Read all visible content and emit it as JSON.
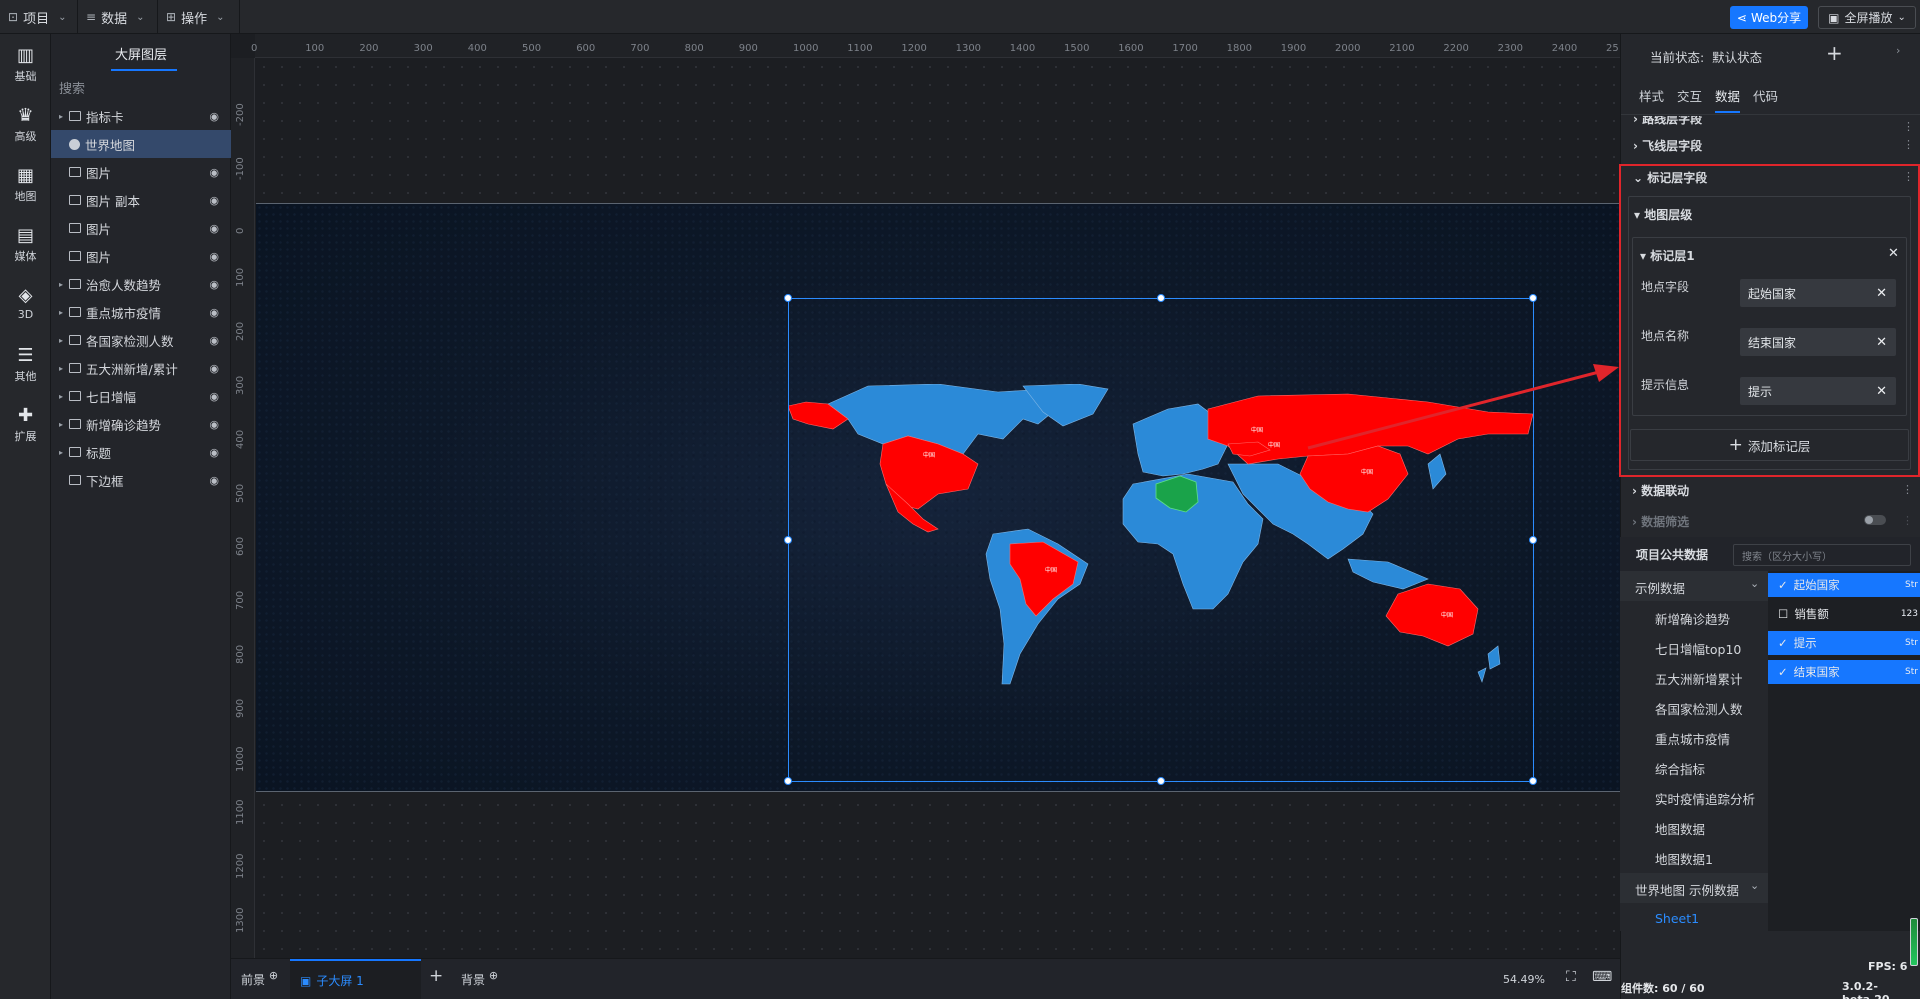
{
  "topbar": {
    "menus": [
      {
        "label": "项目",
        "icon": "project-icon"
      },
      {
        "label": "数据",
        "icon": "database-icon"
      },
      {
        "label": "操作",
        "icon": "grid-icon"
      }
    ],
    "web_share": "Web分享",
    "fullscreen": "全屏播放"
  },
  "left_rail": [
    {
      "label": "基础",
      "icon": "bar-chart-icon"
    },
    {
      "label": "高级",
      "icon": "crown-icon"
    },
    {
      "label": "地图",
      "icon": "map-icon"
    },
    {
      "label": "媒体",
      "icon": "media-icon"
    },
    {
      "label": "3D",
      "icon": "cube-icon"
    },
    {
      "label": "其他",
      "icon": "stack-icon"
    },
    {
      "label": "扩展",
      "icon": "puzzle-icon"
    }
  ],
  "layers": {
    "tab": "大屏图层",
    "search_placeholder": "搜索",
    "items": [
      {
        "label": "指标卡",
        "group": true,
        "selected": false
      },
      {
        "label": "世界地图",
        "group": false,
        "selected": true
      },
      {
        "label": "图片",
        "group": false,
        "selected": false
      },
      {
        "label": "图片 副本",
        "group": false,
        "selected": false
      },
      {
        "label": "图片",
        "group": false,
        "selected": false
      },
      {
        "label": "图片",
        "group": false,
        "selected": false
      },
      {
        "label": "治愈人数趋势",
        "group": true,
        "selected": false
      },
      {
        "label": "重点城市疫情",
        "group": true,
        "selected": false
      },
      {
        "label": "各国家检测人数",
        "group": true,
        "selected": false
      },
      {
        "label": "五大洲新增/累计",
        "group": true,
        "selected": false
      },
      {
        "label": "七日增幅",
        "group": true,
        "selected": false
      },
      {
        "label": "新增确诊趋势",
        "group": true,
        "selected": false
      },
      {
        "label": "标题",
        "group": true,
        "selected": false
      },
      {
        "label": "下边框",
        "group": false,
        "selected": false
      }
    ]
  },
  "ruler": {
    "h": [
      "0",
      "100",
      "200",
      "300",
      "400",
      "500",
      "600",
      "700",
      "800",
      "900",
      "1000",
      "1100",
      "1200",
      "1300",
      "1400",
      "1500",
      "1600",
      "1700",
      "1800",
      "1900",
      "2000",
      "2100",
      "2200",
      "2300",
      "2400",
      "25"
    ],
    "v": [
      "-200",
      "-100",
      "0",
      "100",
      "200",
      "300",
      "400",
      "500",
      "600",
      "700",
      "800",
      "900",
      "1000",
      "1100",
      "1200",
      "1300"
    ]
  },
  "canvas": {
    "zoom": "54.49%",
    "map_markers": [
      "中国",
      "中国",
      "中国",
      "中国",
      "中国",
      "中国"
    ],
    "colors": {
      "highlight": "#ff0000",
      "base": "#2b8ad8",
      "origin": "#1aa34a",
      "selection": "#2b8cff"
    }
  },
  "bottom": {
    "front": "前景",
    "active_tab": "子大屏 1",
    "back": "背景"
  },
  "right": {
    "state_label": "当前状态:",
    "state_value": "默认状态",
    "tabs": [
      "样式",
      "交互",
      "数据",
      "代码"
    ],
    "active_tab": "数据",
    "sections": {
      "route": "路线层字段",
      "flyline": "飞线层字段",
      "marker": "标记层字段",
      "map_level": "地图层级",
      "marker_layer": "标记层1",
      "add_marker": "添加标记层",
      "linkage": "数据联动",
      "filter": "数据筛选"
    },
    "fields": [
      {
        "label": "地点字段",
        "value": "起始国家"
      },
      {
        "label": "地点名称",
        "value": "结束国家"
      },
      {
        "label": "提示信息",
        "value": "提示"
      }
    ],
    "public_data": {
      "title": "项目公共数据",
      "search_placeholder": "搜索（区分大小写）",
      "group1": "示例数据",
      "items": [
        "新增确诊趋势",
        "七日增幅top10",
        "五大洲新增累计",
        "各国家检测人数",
        "重点城市疫情",
        "综合指标",
        "实时疫情追踪分析",
        "地图数据",
        "地图数据1"
      ],
      "group2": "世界地图 示例数据",
      "sheet": "Sheet1",
      "fields": [
        {
          "name": "起始国家",
          "checked": true,
          "type": "Str"
        },
        {
          "name": "销售额",
          "checked": false,
          "type": "123"
        },
        {
          "name": "提示",
          "checked": true,
          "type": "Str"
        },
        {
          "name": "结束国家",
          "checked": true,
          "type": "Str"
        }
      ]
    },
    "fps": "FPS: 6",
    "component_count": "组件数: 60 / 60",
    "version": "3.0.2-beta.20"
  }
}
